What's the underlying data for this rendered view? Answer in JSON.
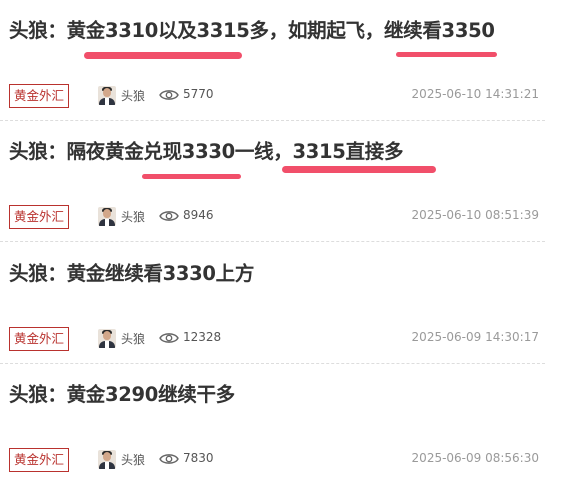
{
  "articles": [
    {
      "title": "头狼：黄金3310以及3315多，如期起飞，继续看3350",
      "category": "黄金外汇",
      "author": "头狼",
      "views": "5770",
      "date": "2025-06-10 14:31:21"
    },
    {
      "title": "头狼：隔夜黄金兑现3330一线，3315直接多",
      "category": "黄金外汇",
      "author": "头狼",
      "views": "8946",
      "date": "2025-06-10 08:51:39"
    },
    {
      "title": "头狼：黄金继续看3330上方",
      "category": "黄金外汇",
      "author": "头狼",
      "views": "12328",
      "date": "2025-06-09 14:30:17"
    },
    {
      "title": "头狼：黄金3290继续干多",
      "category": "黄金外汇",
      "author": "头狼",
      "views": "7830",
      "date": "2025-06-09 08:56:30"
    }
  ],
  "colors": {
    "highlight": "#f14f6a",
    "category": "#b9322e"
  },
  "icons": {
    "views": "eye-icon"
  }
}
